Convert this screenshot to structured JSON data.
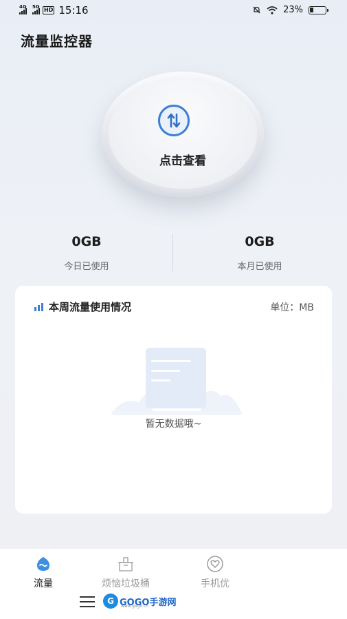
{
  "status_bar": {
    "net1": "4G",
    "net2": "5G",
    "hd": "HD",
    "time": "15:16",
    "battery": "23%",
    "battery_level": 0.23
  },
  "header": {
    "title": "流量监控器"
  },
  "check": {
    "label": "点击查看",
    "icon": "up-down-arrows-icon"
  },
  "stats": {
    "today": {
      "value": "0GB",
      "label": "今日已使用"
    },
    "month": {
      "value": "0GB",
      "label": "本月已使用"
    }
  },
  "weekly_card": {
    "title": "本周流量使用情况",
    "unit": "单位：MB",
    "empty_text": "暂无数据哦~"
  },
  "bottom_nav": {
    "items": [
      {
        "label": "流量",
        "icon": "wave-drop-icon",
        "active": true
      },
      {
        "label": "烦恼垃圾桶",
        "icon": "trash-bin-icon",
        "active": false
      },
      {
        "label": "手机优",
        "icon": "heart-icon",
        "active": false
      }
    ]
  },
  "watermark": {
    "text": "GOGO手游网",
    "sub": "www.gogo.cn"
  },
  "colors": {
    "accent": "#3d7fd6",
    "background": "#eef1f6",
    "card": "#ffffff"
  }
}
